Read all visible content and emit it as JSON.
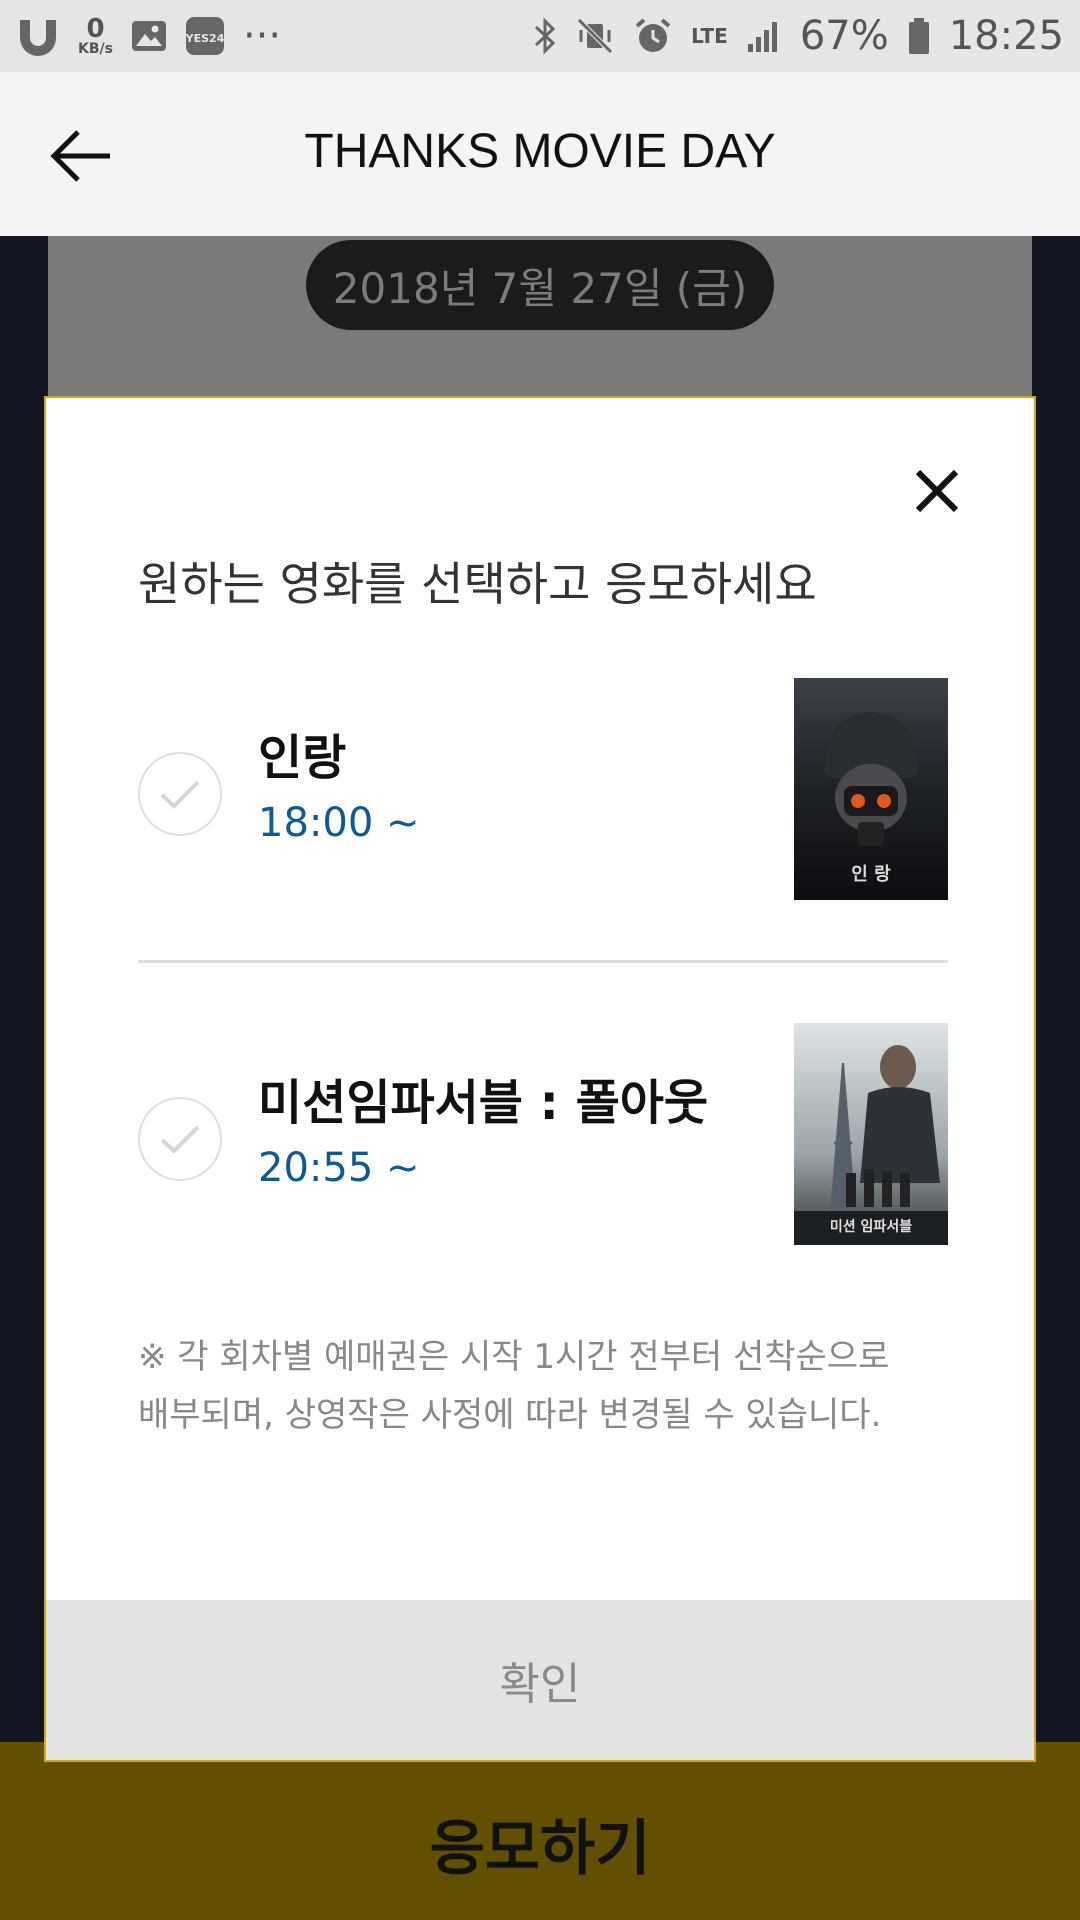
{
  "status_bar": {
    "speed_value": "0",
    "speed_unit": "KB/s",
    "app_badge": "YES24",
    "more": "···",
    "network": "LTE",
    "battery": "67%",
    "time": "18:25"
  },
  "header": {
    "title": "THANKS MOVIE DAY"
  },
  "background": {
    "date": "2018년 7월 27일 (금)",
    "submit_label": "응모하기"
  },
  "modal": {
    "heading": "원하는 영화를 선택하고 응모하세요",
    "movies": [
      {
        "title": "인랑",
        "time": "18:00 ~",
        "poster_text": "인 랑"
      },
      {
        "title": "미션임파서블 : 폴아웃",
        "time": "20:55 ~",
        "poster_text": "미션 임파서블"
      }
    ],
    "notice_line1": "※ 각 회차별 예매권은 시작 1시간 전부터 선착순으로",
    "notice_line2": "배부되며, 상영작은 사정에 따라 변경될 수 있습니다.",
    "confirm_label": "확인"
  },
  "colors": {
    "accent_time": "#0d5a93",
    "modal_border": "#d9a21a",
    "bottom_bar": "#625000"
  }
}
